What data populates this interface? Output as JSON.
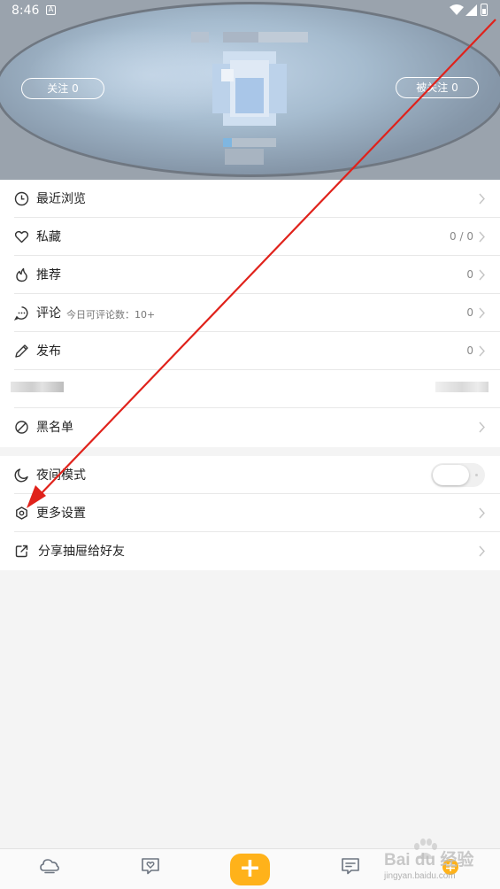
{
  "status_bar": {
    "time": "8:46",
    "app_icon": "app-notification-icon"
  },
  "profile": {
    "follow_label": "关注 0",
    "fans_label": "被关注 0"
  },
  "menu_section_1": [
    {
      "label": "最近浏览",
      "value": "",
      "icon": "clock-icon"
    },
    {
      "label": "私藏",
      "value": "0 / 0",
      "icon": "heart-icon"
    },
    {
      "label": "推荐",
      "value": "0",
      "icon": "flame-icon"
    },
    {
      "label": "评论",
      "sub": "今日可评论数：10+",
      "value": "0",
      "icon": "comment-icon"
    },
    {
      "label": "发布",
      "value": "0",
      "icon": "pencil-icon"
    },
    {
      "label": "黑名单",
      "value": "",
      "icon": "ban-icon"
    }
  ],
  "menu_section_2": [
    {
      "label": "夜间模式",
      "icon": "moon-icon",
      "toggle_on": false
    },
    {
      "label": "更多设置",
      "icon": "settings-icon"
    },
    {
      "label": "分享抽屉给好友",
      "icon": "share-icon"
    }
  ],
  "bottom_nav": {
    "plus_label": "+"
  },
  "watermark": {
    "text": "Bai du 经验",
    "url": "jingyan.baidu.com"
  },
  "colors": {
    "accent": "#ffb21a",
    "arrow": "#e0221b"
  }
}
